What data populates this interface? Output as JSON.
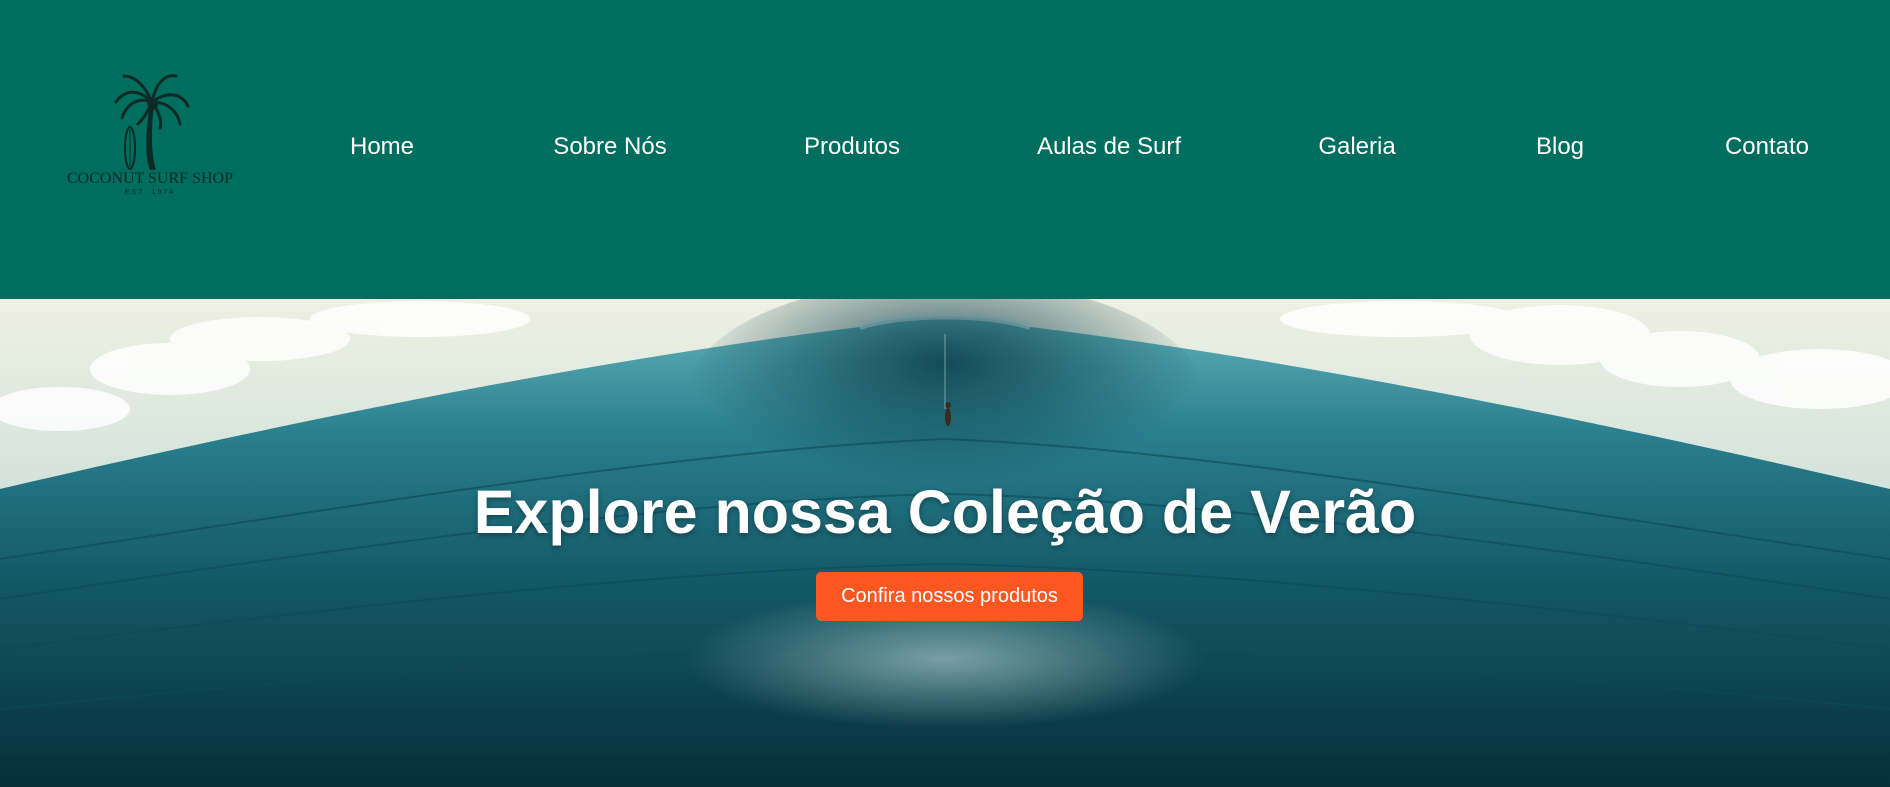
{
  "brand": {
    "name": "COCONUT SURF SHOP",
    "tagline": "EST. 1974",
    "logo_icon": "palm-tree-surfboard-icon",
    "header_color": "#006e5f"
  },
  "nav": {
    "items": [
      {
        "label": "Home"
      },
      {
        "label": "Sobre Nós"
      },
      {
        "label": "Produtos"
      },
      {
        "label": "Aulas de Surf"
      },
      {
        "label": "Galeria"
      },
      {
        "label": "Blog"
      },
      {
        "label": "Contato"
      }
    ]
  },
  "hero": {
    "title": "Explore nossa Coleção de Verão",
    "button_label": "Confira nossos produtos",
    "button_color": "#ff5722",
    "image": "ocean-wave-with-surfer"
  }
}
